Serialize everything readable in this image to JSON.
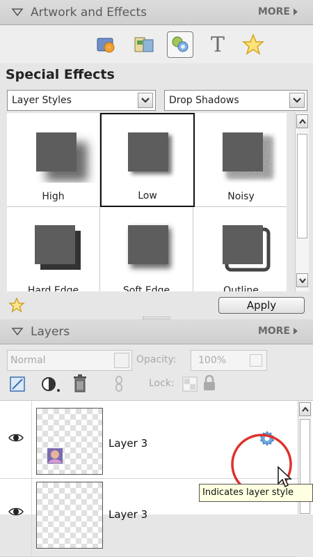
{
  "artwork_panel": {
    "title": "Artwork and Effects",
    "more_label": "MORE"
  },
  "toolbar": {
    "icons": [
      "photo-effects-icon",
      "frames-icon",
      "special-effects-icon",
      "text-icon",
      "favorites-star-icon"
    ],
    "selected_index": 2,
    "text_glyph": "T"
  },
  "special_effects": {
    "title": "Special Effects",
    "category_dropdown": "Layer Styles",
    "subcategory_dropdown": "Drop Shadows",
    "thumbnails": [
      {
        "label": "High"
      },
      {
        "label": "Low",
        "selected": true
      },
      {
        "label": "Noisy"
      },
      {
        "label": "Hard Edge"
      },
      {
        "label": "Soft Edge"
      },
      {
        "label": "Outline"
      }
    ],
    "apply_label": "Apply"
  },
  "layers_panel": {
    "title": "Layers",
    "more_label": "MORE",
    "blend_mode": "Normal",
    "opacity_label": "Opacity:",
    "opacity_value": "100%",
    "lock_label": "Lock:",
    "layers": [
      {
        "name": "Layer 3",
        "has_style": true
      },
      {
        "name": "Layer 3",
        "has_style": false
      }
    ]
  },
  "tooltip": {
    "text": "Indicates layer style"
  },
  "colors": {
    "header_bg": "#d4d4d4",
    "highlight_circle": "#e0302a",
    "style_gear": "#6fa8dc"
  }
}
